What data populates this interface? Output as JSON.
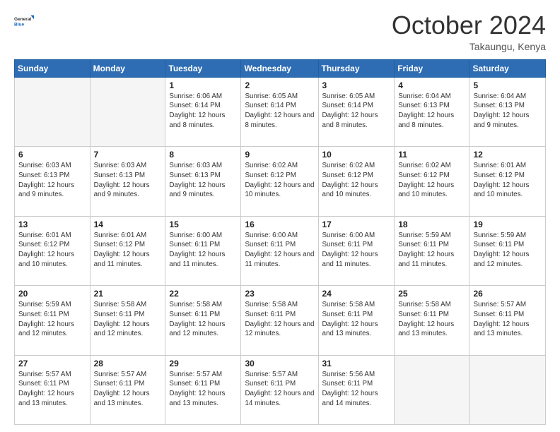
{
  "logo": {
    "line1": "General",
    "line2": "Blue"
  },
  "title": "October 2024",
  "subtitle": "Takaungu, Kenya",
  "weekdays": [
    "Sunday",
    "Monday",
    "Tuesday",
    "Wednesday",
    "Thursday",
    "Friday",
    "Saturday"
  ],
  "weeks": [
    [
      {
        "day": "",
        "info": ""
      },
      {
        "day": "",
        "info": ""
      },
      {
        "day": "1",
        "info": "Sunrise: 6:06 AM\nSunset: 6:14 PM\nDaylight: 12 hours and 8 minutes."
      },
      {
        "day": "2",
        "info": "Sunrise: 6:05 AM\nSunset: 6:14 PM\nDaylight: 12 hours and 8 minutes."
      },
      {
        "day": "3",
        "info": "Sunrise: 6:05 AM\nSunset: 6:14 PM\nDaylight: 12 hours and 8 minutes."
      },
      {
        "day": "4",
        "info": "Sunrise: 6:04 AM\nSunset: 6:13 PM\nDaylight: 12 hours and 8 minutes."
      },
      {
        "day": "5",
        "info": "Sunrise: 6:04 AM\nSunset: 6:13 PM\nDaylight: 12 hours and 9 minutes."
      }
    ],
    [
      {
        "day": "6",
        "info": "Sunrise: 6:03 AM\nSunset: 6:13 PM\nDaylight: 12 hours and 9 minutes."
      },
      {
        "day": "7",
        "info": "Sunrise: 6:03 AM\nSunset: 6:13 PM\nDaylight: 12 hours and 9 minutes."
      },
      {
        "day": "8",
        "info": "Sunrise: 6:03 AM\nSunset: 6:13 PM\nDaylight: 12 hours and 9 minutes."
      },
      {
        "day": "9",
        "info": "Sunrise: 6:02 AM\nSunset: 6:12 PM\nDaylight: 12 hours and 10 minutes."
      },
      {
        "day": "10",
        "info": "Sunrise: 6:02 AM\nSunset: 6:12 PM\nDaylight: 12 hours and 10 minutes."
      },
      {
        "day": "11",
        "info": "Sunrise: 6:02 AM\nSunset: 6:12 PM\nDaylight: 12 hours and 10 minutes."
      },
      {
        "day": "12",
        "info": "Sunrise: 6:01 AM\nSunset: 6:12 PM\nDaylight: 12 hours and 10 minutes."
      }
    ],
    [
      {
        "day": "13",
        "info": "Sunrise: 6:01 AM\nSunset: 6:12 PM\nDaylight: 12 hours and 10 minutes."
      },
      {
        "day": "14",
        "info": "Sunrise: 6:01 AM\nSunset: 6:12 PM\nDaylight: 12 hours and 11 minutes."
      },
      {
        "day": "15",
        "info": "Sunrise: 6:00 AM\nSunset: 6:11 PM\nDaylight: 12 hours and 11 minutes."
      },
      {
        "day": "16",
        "info": "Sunrise: 6:00 AM\nSunset: 6:11 PM\nDaylight: 12 hours and 11 minutes."
      },
      {
        "day": "17",
        "info": "Sunrise: 6:00 AM\nSunset: 6:11 PM\nDaylight: 12 hours and 11 minutes."
      },
      {
        "day": "18",
        "info": "Sunrise: 5:59 AM\nSunset: 6:11 PM\nDaylight: 12 hours and 11 minutes."
      },
      {
        "day": "19",
        "info": "Sunrise: 5:59 AM\nSunset: 6:11 PM\nDaylight: 12 hours and 12 minutes."
      }
    ],
    [
      {
        "day": "20",
        "info": "Sunrise: 5:59 AM\nSunset: 6:11 PM\nDaylight: 12 hours and 12 minutes."
      },
      {
        "day": "21",
        "info": "Sunrise: 5:58 AM\nSunset: 6:11 PM\nDaylight: 12 hours and 12 minutes."
      },
      {
        "day": "22",
        "info": "Sunrise: 5:58 AM\nSunset: 6:11 PM\nDaylight: 12 hours and 12 minutes."
      },
      {
        "day": "23",
        "info": "Sunrise: 5:58 AM\nSunset: 6:11 PM\nDaylight: 12 hours and 12 minutes."
      },
      {
        "day": "24",
        "info": "Sunrise: 5:58 AM\nSunset: 6:11 PM\nDaylight: 12 hours and 13 minutes."
      },
      {
        "day": "25",
        "info": "Sunrise: 5:58 AM\nSunset: 6:11 PM\nDaylight: 12 hours and 13 minutes."
      },
      {
        "day": "26",
        "info": "Sunrise: 5:57 AM\nSunset: 6:11 PM\nDaylight: 12 hours and 13 minutes."
      }
    ],
    [
      {
        "day": "27",
        "info": "Sunrise: 5:57 AM\nSunset: 6:11 PM\nDaylight: 12 hours and 13 minutes."
      },
      {
        "day": "28",
        "info": "Sunrise: 5:57 AM\nSunset: 6:11 PM\nDaylight: 12 hours and 13 minutes."
      },
      {
        "day": "29",
        "info": "Sunrise: 5:57 AM\nSunset: 6:11 PM\nDaylight: 12 hours and 13 minutes."
      },
      {
        "day": "30",
        "info": "Sunrise: 5:57 AM\nSunset: 6:11 PM\nDaylight: 12 hours and 14 minutes."
      },
      {
        "day": "31",
        "info": "Sunrise: 5:56 AM\nSunset: 6:11 PM\nDaylight: 12 hours and 14 minutes."
      },
      {
        "day": "",
        "info": ""
      },
      {
        "day": "",
        "info": ""
      }
    ]
  ]
}
